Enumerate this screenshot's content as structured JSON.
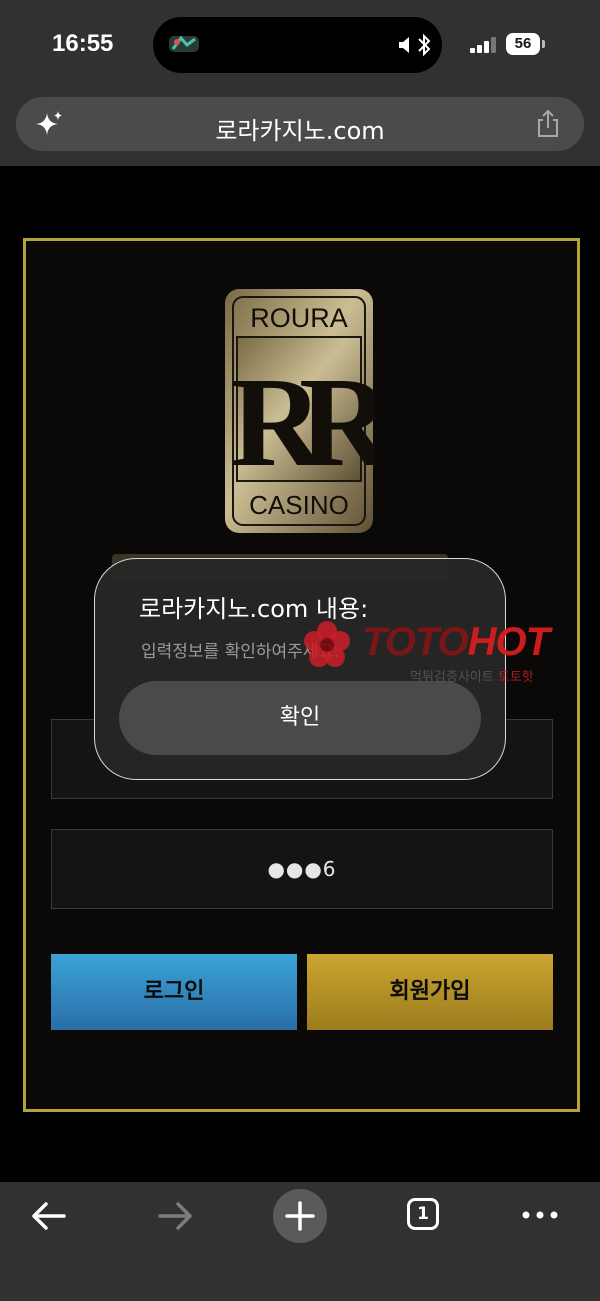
{
  "status_bar": {
    "time": "16:55",
    "battery": "56"
  },
  "browser": {
    "url": "로라카지노.com"
  },
  "page": {
    "logo": {
      "top_text": "ROURA",
      "monogram": "RR",
      "bottom_text": "CASINO"
    },
    "password_value": "●●●6",
    "login_label": "로그인",
    "signup_label": "회원가입",
    "colors": {
      "frame": "#b3a13a",
      "login": "#3a8fc4",
      "signup": "#b8962a"
    }
  },
  "alert": {
    "title": "로라카지노.com 내용:",
    "message": "입력정보를 확인하여주세요.",
    "ok_label": "확인"
  },
  "watermark": {
    "brand_a": "TOTO",
    "brand_b": "HOT",
    "sub_a": "먹튀검증사이트",
    "sub_b": "토토핫"
  },
  "toolbar": {
    "tab_count": "1"
  }
}
